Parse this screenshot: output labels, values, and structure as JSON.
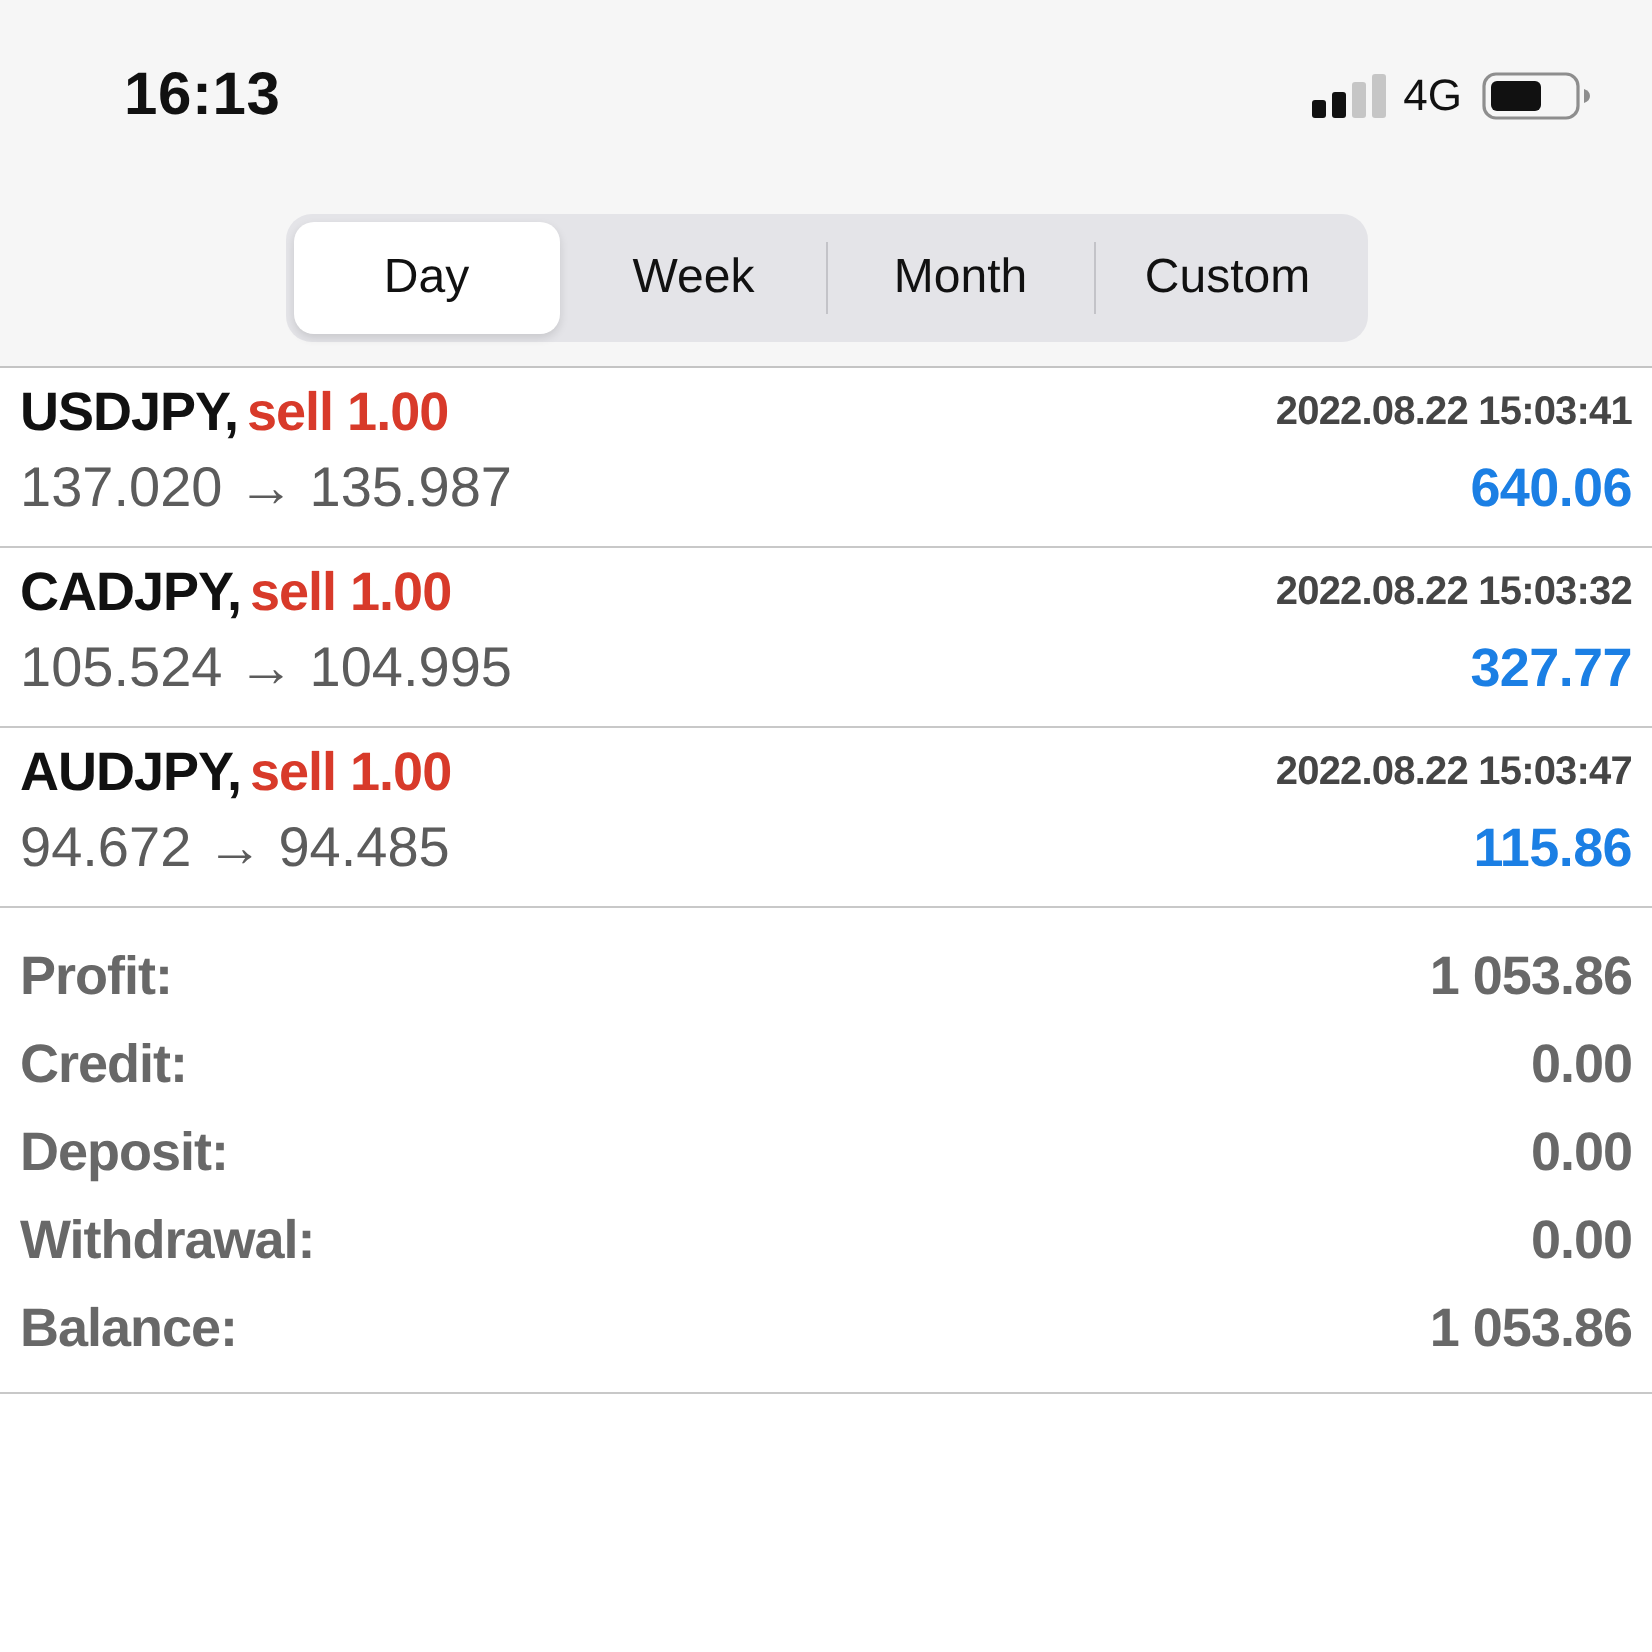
{
  "status_bar": {
    "time": "16:13",
    "network": "4G"
  },
  "period_tabs": [
    {
      "label": "Day",
      "selected": true
    },
    {
      "label": "Week",
      "selected": false
    },
    {
      "label": "Month",
      "selected": false
    },
    {
      "label": "Custom",
      "selected": false
    }
  ],
  "deals": [
    {
      "symbol": "USDJPY,",
      "order": "sell 1.00",
      "time": "2022.08.22 15:03:41",
      "prices": "137.020 → 135.987",
      "profit": "640.06"
    },
    {
      "symbol": "CADJPY,",
      "order": "sell 1.00",
      "time": "2022.08.22 15:03:32",
      "prices": "105.524 → 104.995",
      "profit": "327.77"
    },
    {
      "symbol": "AUDJPY,",
      "order": "sell 1.00",
      "time": "2022.08.22 15:03:47",
      "prices": "94.672 → 94.485",
      "profit": "115.86"
    }
  ],
  "summary": [
    {
      "label": "Profit:",
      "value": "1 053.86"
    },
    {
      "label": "Credit:",
      "value": "0.00"
    },
    {
      "label": "Deposit:",
      "value": "0.00"
    },
    {
      "label": "Withdrawal:",
      "value": "0.00"
    },
    {
      "label": "Balance:",
      "value": "1 053.86"
    }
  ]
}
